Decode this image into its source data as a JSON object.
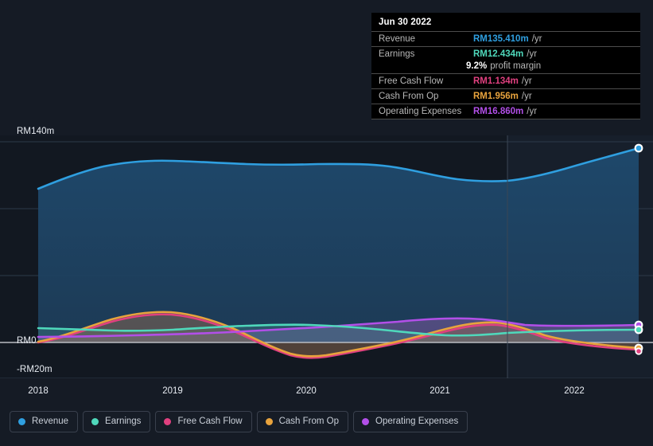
{
  "colors": {
    "background": "#151b25",
    "revenue": "#2f9fe0",
    "earnings": "#4fd8bb",
    "free_cash_flow": "#e0407f",
    "cash_from_op": "#e8a33d",
    "operating_expenses": "#b24fe8",
    "zero_line": "#b9bcc2",
    "gridline": "#2c3a49",
    "tooltip_background": "#000000",
    "axis_text": "#e8ecf2"
  },
  "tooltip": {
    "date": "Jun 30 2022",
    "rows": [
      {
        "label": "Revenue",
        "value": "RM135.410m",
        "unit": "/yr",
        "color": "#2f9fe0"
      },
      {
        "label": "Earnings",
        "value": "RM12.434m",
        "unit": "/yr",
        "color": "#4fd8bb"
      },
      {
        "label": "",
        "value": "9.2%",
        "unit": "profit margin",
        "color": "#ffffff"
      },
      {
        "label": "Free Cash Flow",
        "value": "RM1.134m",
        "unit": "/yr",
        "color": "#e0407f"
      },
      {
        "label": "Cash From Op",
        "value": "RM1.956m",
        "unit": "/yr",
        "color": "#e8a33d"
      },
      {
        "label": "Operating Expenses",
        "value": "RM16.860m",
        "unit": "/yr",
        "color": "#b24fe8"
      }
    ]
  },
  "legend": {
    "items": [
      {
        "label": "Revenue",
        "color": "#2f9fe0"
      },
      {
        "label": "Earnings",
        "color": "#4fd8bb"
      },
      {
        "label": "Free Cash Flow",
        "color": "#e0407f"
      },
      {
        "label": "Cash From Op",
        "color": "#e8a33d"
      },
      {
        "label": "Operating Expenses",
        "color": "#b24fe8"
      }
    ]
  },
  "axes": {
    "y_top_label": "RM140m",
    "y_zero_label": "RM0",
    "y_bottom_label": "-RM20m",
    "x_labels": [
      "2018",
      "2019",
      "2020",
      "2021",
      "2022"
    ]
  },
  "chart_data": {
    "type": "area",
    "title": "",
    "xlabel": "",
    "ylabel": "",
    "ylim": [
      -20,
      140
    ],
    "yticks": [
      140,
      0,
      -20
    ],
    "ytick_labels": [
      "RM140m",
      "RM0",
      "-RM20m"
    ],
    "grid": true,
    "legend_position": "bottom",
    "currency": "RM",
    "units": "millions per year",
    "x": [
      2018.0,
      2018.25,
      2018.5,
      2018.75,
      2019.0,
      2019.25,
      2019.5,
      2019.75,
      2020.0,
      2020.25,
      2020.5,
      2020.75,
      2021.0,
      2021.25,
      2021.5,
      2021.75,
      2022.0,
      2022.25,
      2022.5
    ],
    "categories": [
      "2018",
      "2019",
      "2020",
      "2021",
      "2022"
    ],
    "forecast_divider_x": 2021.5,
    "series": [
      {
        "name": "Revenue",
        "color": "#2f9fe0",
        "values": [
          117.0,
          121.0,
          124.5,
          127.5,
          129.0,
          129.5,
          129.2,
          128.8,
          128.5,
          128.5,
          128.8,
          128.5,
          126.0,
          122.5,
          121.0,
          121.5,
          124.5,
          129.5,
          135.41
        ],
        "last_value": 135.41,
        "last_label": "RM135.410m"
      },
      {
        "name": "Earnings",
        "color": "#4fd8bb",
        "values": [
          11.5,
          11.2,
          10.8,
          10.4,
          10.2,
          10.3,
          10.8,
          11.4,
          11.9,
          12.2,
          12.1,
          11.6,
          10.6,
          9.6,
          9.0,
          9.2,
          10.2,
          11.4,
          12.434
        ],
        "last_value": 12.434,
        "last_label": "RM12.434m"
      },
      {
        "name": "Free Cash Flow",
        "color": "#e0407f",
        "values": [
          0.3,
          2.5,
          5.4,
          8.0,
          9.2,
          8.6,
          6.2,
          2.8,
          -1.1,
          -3.2,
          -3.5,
          -2.4,
          0.2,
          3.2,
          5.6,
          6.6,
          5.2,
          2.7,
          1.134
        ],
        "last_value": 1.134,
        "last_label": "RM1.134m"
      },
      {
        "name": "Cash From Op",
        "color": "#e8a33d",
        "values": [
          0.6,
          3.0,
          6.0,
          8.6,
          9.8,
          9.2,
          6.8,
          3.3,
          -0.6,
          -2.7,
          -3.0,
          -1.9,
          0.8,
          3.8,
          6.2,
          7.2,
          5.8,
          3.3,
          1.956
        ],
        "last_value": 1.956,
        "last_label": "RM1.956m"
      },
      {
        "name": "Operating Expenses",
        "color": "#b24fe8",
        "values": [
          5.6,
          5.6,
          5.6,
          5.6,
          5.7,
          5.8,
          5.9,
          6.1,
          6.3,
          6.6,
          7.0,
          7.6,
          8.4,
          9.4,
          10.5,
          11.8,
          13.4,
          15.2,
          16.86
        ],
        "last_value": 16.86,
        "last_label": "RM16.860m"
      }
    ]
  }
}
